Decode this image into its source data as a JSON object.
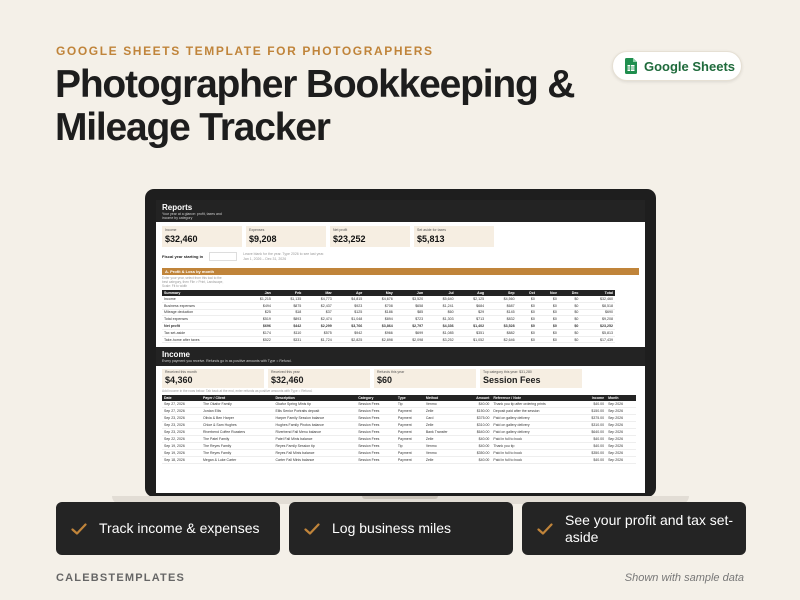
{
  "header": {
    "kicker": "GOOGLE SHEETS TEMPLATE FOR PHOTOGRAPHERS",
    "title_line1": "Photographer Bookkeeping &",
    "title_line2": "Mileage Tracker",
    "badge_label": "Google Sheets",
    "badge_icon": "google-sheets-icon"
  },
  "reports": {
    "title": "Reports",
    "subtitle_line1": "Your year at a glance: profit, taxes and",
    "subtitle_line2": "income by category",
    "kpis": [
      {
        "label": "Income",
        "value": "$32,460"
      },
      {
        "label": "Expenses",
        "value": "$9,208"
      },
      {
        "label": "Net profit",
        "value": "$23,252"
      },
      {
        "label": "Set aside for taxes",
        "value": "$5,813"
      }
    ],
    "fiscal_label": "Fiscal year starting in",
    "fiscal_hint_line1": "Leave blank for the year. Type 2026 to see last year.",
    "fiscal_hint_line2": "Jan 1, 2026 – Dec 31, 2026",
    "pl_title": "A. Profit & Loss by month",
    "pl_note_line1": "Enter your year, select from this tool to the",
    "pl_note_line2": "best category, then File > Print, Landscape,",
    "pl_note_line3": "Scale: Fit to width",
    "pl_headers": [
      "Summary",
      "Jan",
      "Feb",
      "Mar",
      "Apr",
      "May",
      "Jun",
      "Jul",
      "Aug",
      "Sep",
      "Oct",
      "Nov",
      "Dec",
      "Total"
    ],
    "pl_rows": [
      {
        "cells": [
          "Income",
          "$1,215",
          "$1,135",
          "$4,773",
          "$4,815",
          "$4,676",
          "$3,520",
          "$5,640",
          "$2,125",
          "$4,560",
          "$0",
          "$0",
          "$0",
          "$32,460"
        ]
      },
      {
        "cells": [
          "Business expenses",
          "$494",
          "$875",
          "$2,437",
          "$923",
          "$708",
          "$658",
          "$1,241",
          "$684",
          "$687",
          "$0",
          "$0",
          "$0",
          "$8,518"
        ]
      },
      {
        "cells": [
          "Mileage deduction",
          "$25",
          "$18",
          "$37",
          "$125",
          "$186",
          "$85",
          "$60",
          "$29",
          "$145",
          "$0",
          "$0",
          "$0",
          "$690"
        ]
      },
      {
        "cells": [
          "Total expenses",
          "$519",
          "$893",
          "$2,474",
          "$1,048",
          "$894",
          "$723",
          "$1,303",
          "$713",
          "$832",
          "$0",
          "$0",
          "$0",
          "$9,208"
        ]
      },
      {
        "cells": [
          "Net profit",
          "$696",
          "$442",
          "$2,299",
          "$3,766",
          "$3,864",
          "$2,797",
          "$4,336",
          "$1,402",
          "$3,528",
          "$0",
          "$0",
          "$0",
          "$23,252"
        ],
        "bold": true
      },
      {
        "cells": [
          "Tax set-aside",
          "$174",
          "$110",
          "$575",
          "$942",
          "$966",
          "$699",
          "$1,085",
          "$351",
          "$882",
          "$0",
          "$0",
          "$0",
          "$5,813"
        ]
      },
      {
        "cells": [
          "Take-home after taxes",
          "$522",
          "$331",
          "$1,724",
          "$2,825",
          "$2,898",
          "$2,098",
          "$3,252",
          "$1,052",
          "$2,646",
          "$0",
          "$0",
          "$0",
          "$17,439"
        ]
      }
    ]
  },
  "income": {
    "title": "Income",
    "subtitle": "Every payment you receive. Refunds go in as positive amounts with Type = Refund.",
    "kpis": [
      {
        "label": "Received this month",
        "value": "$4,360"
      },
      {
        "label": "Received this year",
        "value": "$32,460"
      },
      {
        "label": "Refunds this year",
        "value": "$60"
      },
      {
        "label": "Top category this year: $31,280",
        "value": "Session Fees"
      }
    ],
    "note": "Add income in the rows below. Tab back at the end, enter refunds as positive amounts with Type = Refund.",
    "headers": [
      "Date",
      "Payer / Client",
      "Description",
      "Category",
      "Type",
      "Method",
      "Amount",
      "Reference / Note",
      "Income",
      "Month"
    ],
    "rows": [
      [
        "Sep 27, 2026",
        "The Okafor Family",
        "Okafor Spring Minis tip",
        "Session Fees",
        "Tip",
        "Venmo",
        "$40.00",
        "Thank you tip after ordering prints",
        "$40.00",
        "Sep 2026"
      ],
      [
        "Sep 27, 2026",
        "Jordan Ellis",
        "Ellis Senior Portraits deposit",
        "Session Fees",
        "Payment",
        "Zelle",
        "$150.00",
        "Deposit paid after the session",
        "$150.00",
        "Sep 2026"
      ],
      [
        "Sep 23, 2026",
        "Olivia & Ben Harper",
        "Harper Family Session balance",
        "Session Fees",
        "Payment",
        "Card",
        "$375.00",
        "Paid on gallery delivery",
        "$375.00",
        "Sep 2026"
      ],
      [
        "Sep 23, 2026",
        "Chloe & Sam Hughes",
        "Hughes Family Photos balance",
        "Session Fees",
        "Payment",
        "Zelle",
        "$310.00",
        "Paid on gallery delivery",
        "$310.00",
        "Sep 2026"
      ],
      [
        "Sep 23, 2026",
        "Riverbend Coffee Roasters",
        "Riverbend Fall Menu balance",
        "Session Fees",
        "Payment",
        "Bank Transfer",
        "$640.00",
        "Paid on gallery delivery",
        "$640.00",
        "Sep 2026"
      ],
      [
        "Sep 22, 2026",
        "The Patel Family",
        "Patel Fall Minis balance",
        "Session Fees",
        "Payment",
        "Zelle",
        "$40.00",
        "Paid in full to book",
        "$40.00",
        "Sep 2026"
      ],
      [
        "Sep 19, 2026",
        "The Reyes Family",
        "Reyes Family Session tip",
        "Session Fees",
        "Tip",
        "Venmo",
        "$40.00",
        "Thank you tip",
        "$40.00",
        "Sep 2026"
      ],
      [
        "Sep 19, 2026",
        "The Reyes Family",
        "Reyes Fall Minis balance",
        "Session Fees",
        "Payment",
        "Venmo",
        "$350.00",
        "Paid in full to book",
        "$350.00",
        "Sep 2026"
      ],
      [
        "Sep 18, 2026",
        "Megan & Luke Carter",
        "Carter Fall Minis balance",
        "Session Fees",
        "Payment",
        "Zelle",
        "$40.00",
        "Paid in full to book",
        "$40.00",
        "Sep 2026"
      ]
    ]
  },
  "features": [
    {
      "label": "Track income & expenses"
    },
    {
      "label": "Log business miles"
    },
    {
      "label": "See your profit and tax set-aside"
    }
  ],
  "footer": {
    "brand": "CALEBSTEMPLATES",
    "note": "Shown with sample data"
  },
  "colors": {
    "accent": "#c0843a",
    "dark": "#232323",
    "sheets_green": "#1f6b3c",
    "kpi_bg": "#f6eee2"
  }
}
